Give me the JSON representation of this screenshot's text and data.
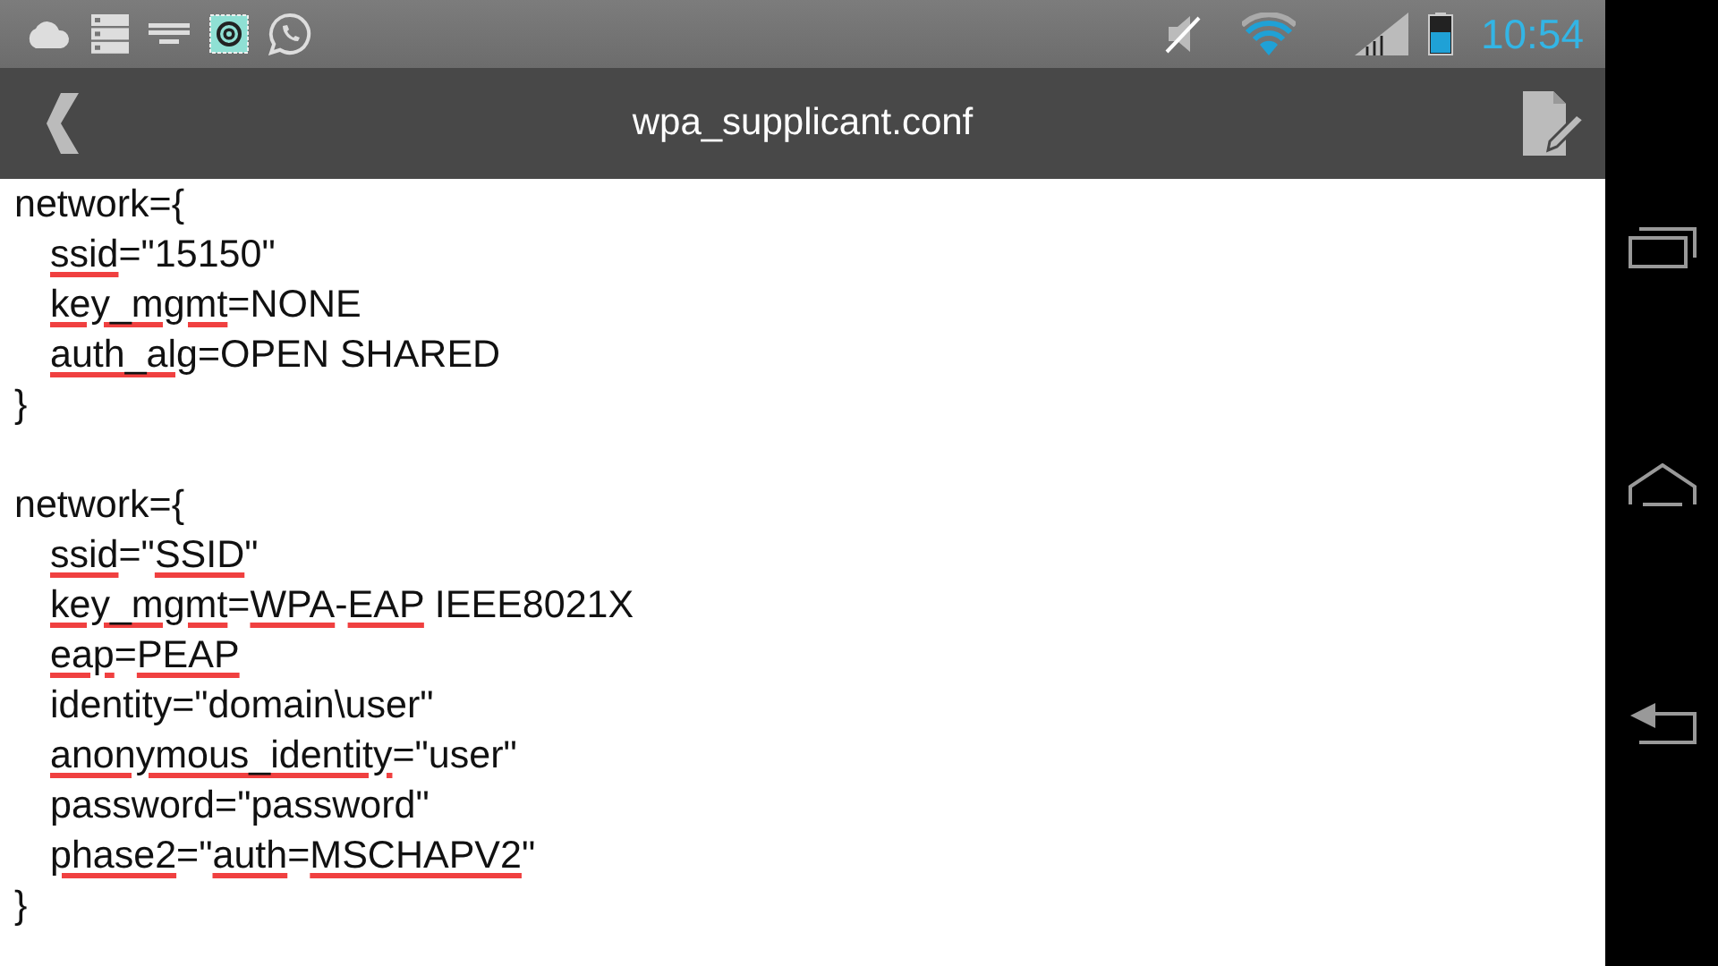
{
  "status_bar": {
    "time": "10:54"
  },
  "action_bar": {
    "title": "wpa_supplicant.conf"
  },
  "editor": {
    "blocks": [
      {
        "header": "network={",
        "entries": [
          [
            {
              "text": "ssid",
              "misspelled": true
            },
            {
              "text": "=\"15150\"",
              "misspelled": false
            }
          ],
          [
            {
              "text": "key_mgmt",
              "misspelled": true
            },
            {
              "text": "=NONE",
              "misspelled": false
            }
          ],
          [
            {
              "text": "auth_alg",
              "misspelled": true
            },
            {
              "text": "=OPEN SHARED",
              "misspelled": false
            }
          ]
        ],
        "footer": "}"
      },
      {
        "header": "network={",
        "entries": [
          [
            {
              "text": "ssid",
              "misspelled": true
            },
            {
              "text": "=\"",
              "misspelled": false
            },
            {
              "text": "SSID",
              "misspelled": true
            },
            {
              "text": "\"",
              "misspelled": false
            }
          ],
          [
            {
              "text": "key_mgmt",
              "misspelled": true
            },
            {
              "text": "=",
              "misspelled": false
            },
            {
              "text": "WPA",
              "misspelled": true
            },
            {
              "text": "-",
              "misspelled": false
            },
            {
              "text": "EAP",
              "misspelled": true
            },
            {
              "text": " IEEE8021X",
              "misspelled": false
            }
          ],
          [
            {
              "text": "eap",
              "misspelled": true
            },
            {
              "text": "=",
              "misspelled": false
            },
            {
              "text": "PEAP",
              "misspelled": true
            }
          ],
          [
            {
              "text": "identity=\"domain\\user\"",
              "misspelled": false
            }
          ],
          [
            {
              "text": "anonymous_identity",
              "misspelled": true
            },
            {
              "text": "=\"user\"",
              "misspelled": false
            }
          ],
          [
            {
              "text": "password=\"password\"",
              "misspelled": false
            }
          ],
          [
            {
              "text": "phase2",
              "misspelled": true
            },
            {
              "text": "=\"",
              "misspelled": false
            },
            {
              "text": "auth",
              "misspelled": true
            },
            {
              "text": "=",
              "misspelled": false
            },
            {
              "text": "MSCHAPV2",
              "misspelled": true
            },
            {
              "text": "\"",
              "misspelled": false
            }
          ]
        ],
        "footer": "}"
      }
    ]
  }
}
